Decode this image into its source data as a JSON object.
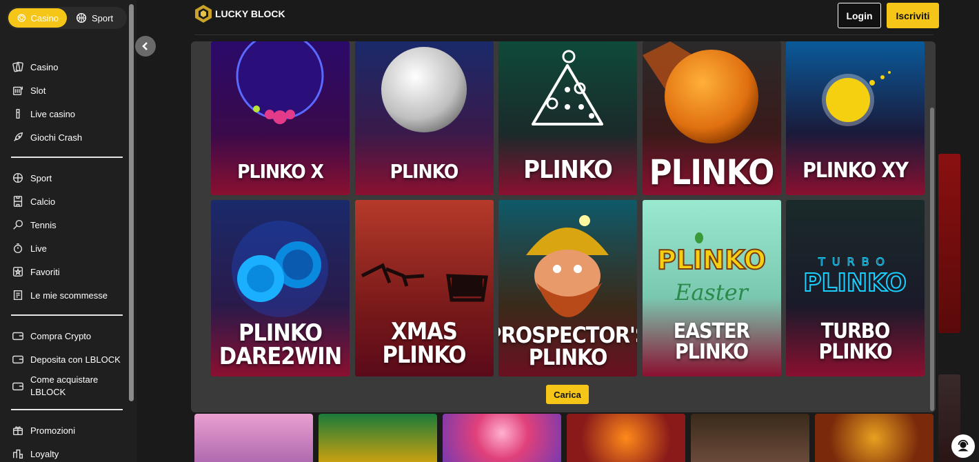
{
  "sidebar": {
    "top_tabs": [
      {
        "label": "Casino",
        "icon": "casino-chip-icon",
        "active": true
      },
      {
        "label": "Sport",
        "icon": "basketball-icon",
        "active": false
      }
    ],
    "groups": [
      [
        {
          "label": "Casino",
          "icon": "cards-icon"
        },
        {
          "label": "Slot",
          "icon": "slot-machine-icon"
        },
        {
          "label": "Live casino",
          "icon": "live-casino-icon"
        },
        {
          "label": "Giochi Crash",
          "icon": "rocket-icon"
        }
      ],
      [
        {
          "label": "Sport",
          "icon": "basketball-icon"
        },
        {
          "label": "Calcio",
          "icon": "football-field-icon"
        },
        {
          "label": "Tennis",
          "icon": "tennis-racket-icon"
        },
        {
          "label": "Live",
          "icon": "stopwatch-icon"
        },
        {
          "label": "Favoriti",
          "icon": "star-icon"
        },
        {
          "label": "Le mie scommesse",
          "icon": "betslip-icon"
        }
      ],
      [
        {
          "label": "Compra Crypto",
          "icon": "wallet-icon"
        },
        {
          "label": "Deposita con LBLOCK",
          "icon": "wallet-icon"
        },
        {
          "label": "Come acquistare LBLOCK",
          "icon": "wallet-icon"
        }
      ],
      [
        {
          "label": "Promozioni",
          "icon": "gift-icon"
        },
        {
          "label": "Loyalty",
          "icon": "loyalty-icon"
        }
      ]
    ]
  },
  "header": {
    "logo_text": "LUCKY BLOCK",
    "login_label": "Login",
    "signup_label": "Iscriviti"
  },
  "games": [
    {
      "title": "PLINKO X",
      "size": 28
    },
    {
      "title": "PLINKO",
      "size": 28
    },
    {
      "title": "PLINKO",
      "size": 36
    },
    {
      "title": "PLINKO",
      "size": 50
    },
    {
      "title": "PLINKO XY",
      "size": 30
    },
    {
      "title": "PLINKO\nDARE2WIN",
      "size": 34
    },
    {
      "title": "XMAS PLINKO",
      "size": 34
    },
    {
      "title": "PROSPECTOR'S\nPLINKO",
      "size": 32
    },
    {
      "title": "EASTER PLINKO",
      "size": 30
    },
    {
      "title": "TURBO PLINKO",
      "size": 30
    }
  ],
  "load_more_label": "Carica",
  "colors": {
    "accent": "#f5c518",
    "background": "#1a1a1a",
    "panel": "#3a3a3a"
  }
}
